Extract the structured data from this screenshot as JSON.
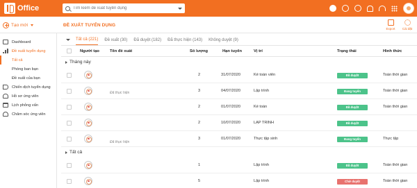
{
  "app": {
    "logo_text": "Office"
  },
  "search": {
    "placeholder": "Tìm kiếm đề xuất tuyển dụng"
  },
  "toolbar": {
    "create_label": "Tạo mới",
    "page_title": "ĐỀ XUẤT TUYỂN DỤNG",
    "export_label": "Export",
    "settings_label": "Cài đặt"
  },
  "sidebar": {
    "items": [
      {
        "label": "Dashboard",
        "icon": "dashboard-icon"
      },
      {
        "label": "Đề xuất tuyển dụng",
        "icon": "bar-chart-icon"
      },
      {
        "label": "Tất cả"
      },
      {
        "label": "Phòng ban bạn"
      },
      {
        "label": "Đề xuất của bạn"
      },
      {
        "label": "Chiến dịch tuyển dụng",
        "icon": "megaphone-icon"
      },
      {
        "label": "Hồ sơ ứng viên",
        "icon": "profile-icon"
      },
      {
        "label": "Lịch phỏng vấn",
        "icon": "calendar-icon"
      },
      {
        "label": "Chăm sóc ứng viên",
        "icon": "care-icon"
      }
    ]
  },
  "tabs": [
    {
      "label": "Tất cả (221)"
    },
    {
      "label": "Đề xuất (30)"
    },
    {
      "label": "Đã duyệt (182)"
    },
    {
      "label": "Đã thực hiện (143)"
    },
    {
      "label": "Không duyệt (9)"
    }
  ],
  "table": {
    "columns": {
      "creator": "Người tạo",
      "proposal": "Tên đề xuất",
      "quantity": "Số lượng",
      "deadline": "Hạn tuyển",
      "position": "Vị trí",
      "status": "Trạng thái",
      "form": "Hình thức"
    },
    "groups": [
      {
        "label": "Tháng này"
      },
      {
        "label": "Tất cả"
      }
    ],
    "rows": [
      {
        "proposal": "",
        "quantity": "2",
        "deadline": "31/07/2020",
        "position": "Kế toán viên",
        "status": "Đã duyệt",
        "status_color": "#4cc38a",
        "form": "Toàn thời gian"
      },
      {
        "proposal": "Đã thực hiện",
        "quantity": "3",
        "deadline": "04/07/2020",
        "position": "Lập trình",
        "status": "Đang tuyển",
        "status_color": "#4cc38a",
        "form": "Toàn thời gian"
      },
      {
        "proposal": "",
        "quantity": "2",
        "deadline": "01/07/2020",
        "position": "Kế toán",
        "status": "Đã duyệt",
        "status_color": "#4cc38a",
        "form": "Toàn thời gian"
      },
      {
        "proposal": "",
        "quantity": "2",
        "deadline": "10/07/2020",
        "position": "LẬP TRÌNH",
        "status": "Đã duyệt",
        "status_color": "#4cc38a",
        "form": ""
      },
      {
        "proposal": "Đã thực hiện",
        "quantity": "3",
        "deadline": "01/07/2020",
        "position": "Thực tập sinh",
        "status": "Đang tuyển",
        "status_color": "#4cc38a",
        "form": "Thực tập"
      },
      {
        "proposal": "",
        "quantity": "1",
        "deadline": "",
        "position": "Lập trình",
        "status": "Đã duyệt",
        "status_color": "#4cc38a",
        "form": "Toàn thời gian"
      },
      {
        "proposal": "",
        "quantity": "5",
        "deadline": "",
        "position": "Lập trình",
        "status": "Chờ duyệt",
        "status_color": "#e8726e",
        "form": "Toàn thời gian"
      }
    ]
  }
}
